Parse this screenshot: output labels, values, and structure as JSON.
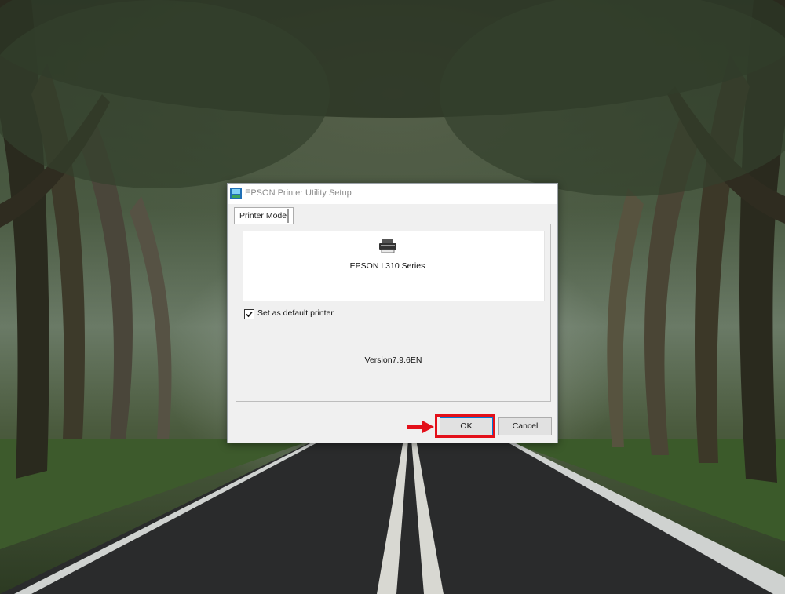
{
  "window": {
    "title": "EPSON Printer Utility Setup"
  },
  "tabs": [
    {
      "label": "Printer Model"
    }
  ],
  "printer_list": {
    "selected_model": "EPSON L310 Series",
    "icon": "printer-icon"
  },
  "default_printer": {
    "label": "Set as default printer",
    "checked": true
  },
  "version_text": "Version7.9.6EN",
  "buttons": {
    "ok_label": "OK",
    "cancel_label": "Cancel"
  },
  "annotation": {
    "highlight_color": "#e3101a",
    "arrow_color": "#e3101a"
  },
  "colors": {
    "dialog_bg": "#f0f0f0",
    "accent": "#0078d7"
  }
}
